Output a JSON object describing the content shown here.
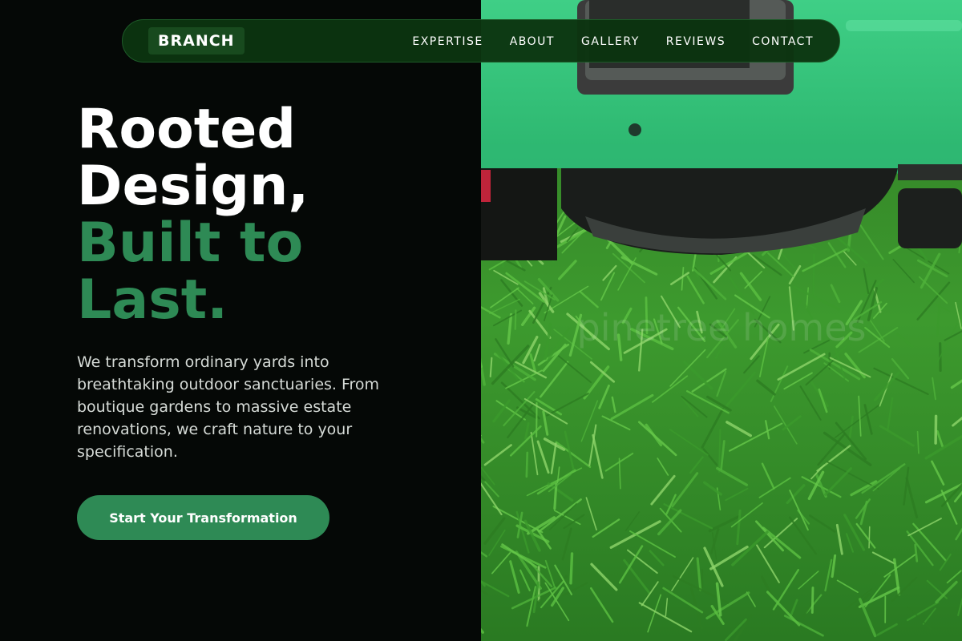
{
  "nav": {
    "logo": "BRANCH",
    "links": [
      "EXPERTISE",
      "ABOUT",
      "GALLERY",
      "REVIEWS",
      "CONTACT"
    ]
  },
  "hero": {
    "headline_white": [
      "Rooted",
      "Design,"
    ],
    "headline_green": [
      "Built to",
      "Last."
    ],
    "description": "We transform ordinary yards into breathtaking outdoor sanctuaries. From boutique gardens to massive estate renovations, we craft nature to your specification.",
    "cta_label": "Start Your Transformation"
  },
  "image": {
    "subject": "lawn-mower-on-grass",
    "watermark": "pinetree homes"
  },
  "colors": {
    "background": "#050806",
    "accent": "#2e8a55",
    "nav_bg": "#0b3410",
    "text_light": "#d6dbd7"
  }
}
